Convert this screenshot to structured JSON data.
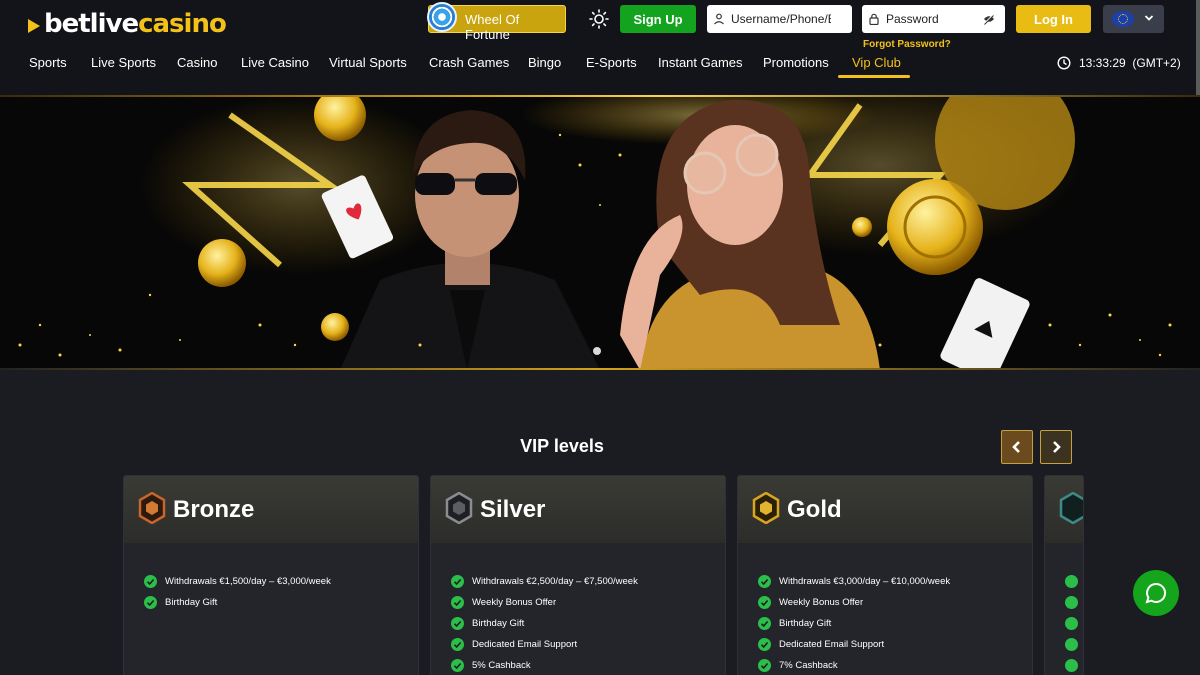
{
  "header": {
    "logo": {
      "part1": "betlive",
      "part2": "casino"
    },
    "wheel_of_fortune": "Wheel Of Fortune",
    "theme_icon": "sun-icon",
    "signup_label": "Sign Up",
    "username_placeholder": "Username/Phone/Email",
    "password_placeholder": "Password",
    "forgot_password": "Forgot Password?",
    "login_label": "Log In",
    "language_icon": "eu-flag-icon",
    "time": "13:33:29",
    "timezone": "(GMT+2)"
  },
  "nav": {
    "items": [
      {
        "label": "Sports"
      },
      {
        "label": "Live Sports"
      },
      {
        "label": "Casino"
      },
      {
        "label": "Live Casino"
      },
      {
        "label": "Virtual Sports"
      },
      {
        "label": "Crash Games"
      },
      {
        "label": "Bingo"
      },
      {
        "label": "E-Sports"
      },
      {
        "label": "Instant Games"
      },
      {
        "label": "Promotions"
      },
      {
        "label": "Vip Club"
      }
    ],
    "active": "Vip Club"
  },
  "vip": {
    "title": "VIP levels",
    "levels": [
      {
        "name": "Bronze",
        "benefits": [
          "Withdrawals €1,500/day – €3,000/week",
          "Birthday Gift"
        ]
      },
      {
        "name": "Silver",
        "benefits": [
          "Withdrawals €2,500/day – €7,500/week",
          "Weekly Bonus Offer",
          "Birthday Gift",
          "Dedicated Email Support",
          "5% Cashback"
        ]
      },
      {
        "name": "Gold",
        "benefits": [
          "Withdrawals €3,000/day – €10,000/week",
          "Weekly Bonus Offer",
          "Birthday Gift",
          "Dedicated Email Support",
          "7% Cashback"
        ]
      }
    ]
  },
  "colors": {
    "accent": "#f2c21b",
    "signup": "#13a31e",
    "login": "#e9bc13",
    "background": "#1b1c21",
    "header": "#131419",
    "check": "#2bbf4a"
  }
}
